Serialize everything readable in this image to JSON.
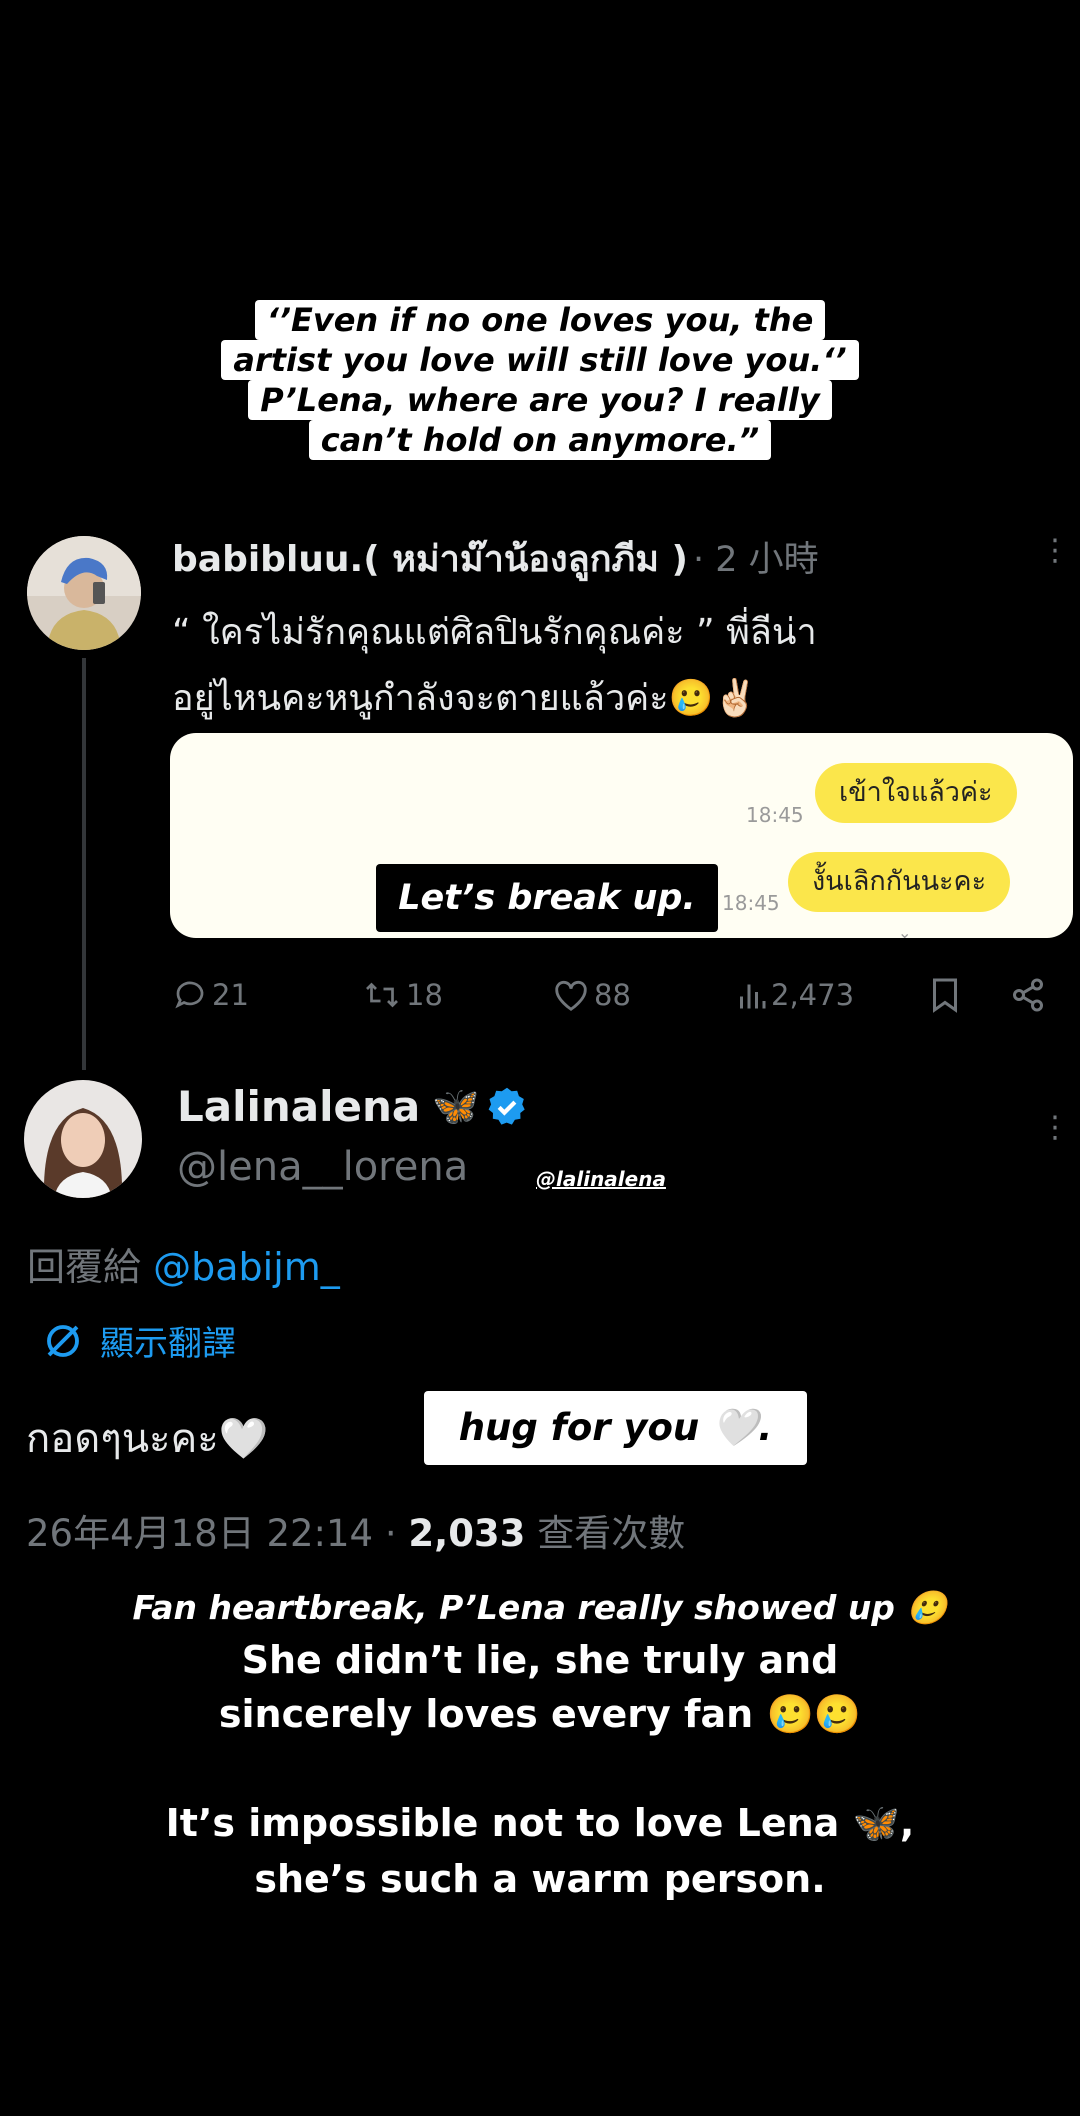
{
  "caption_top": {
    "lines": [
      "‘’Even if no one loves you, the",
      "artist you love will still love you.‘’",
      "P’Lena, where are you? I really",
      "can’t hold on anymore.”"
    ]
  },
  "first_post": {
    "display_name": "babibluu.( หม่าม๊าน้องลูกภีม )",
    "time": "· 2 小時",
    "text_line1": "“ ใครไม่รักคุณแต่ศิลปินรักคุณค่ะ ” พี่ลีน่า",
    "text_line2": "อยู่ไหนคะหนูกำลังจะตายแล้วค่ะ🥲✌🏻",
    "chat": {
      "bubble1": "เข้าใจแล้วค่ะ",
      "bubble2": "งั้นเลิกกันนะคะ",
      "time1": "18:45",
      "time2": "18:45",
      "overlay": "Let’s break up."
    },
    "stats": {
      "replies": "21",
      "reposts": "18",
      "likes": "88",
      "views": "2,473"
    }
  },
  "reply": {
    "display_name": "Lalinalena",
    "badge_emoji": "🦋",
    "handle": "@lena__lorena",
    "ig_tag": "@lalinalena",
    "reply_to_prefix": "回覆給",
    "reply_to_handle": "@babijm_",
    "translate_label": "顯示翻譯",
    "text": "กอดๆนะคะ🤍",
    "overlay": "hug for you 🤍.",
    "date": "26年4月18日 22:14 ·",
    "views_count": "2,033",
    "views_label": "查看次數"
  },
  "footer": {
    "line1": "Fan heartbreak, P’Lena really showed up 🥲",
    "line2": "She didn’t lie, she truly and",
    "line3": "sincerely loves every fan 🥲🥲",
    "line4": "It’s impossible not to love Lena 🦋,",
    "line5": "she’s such a warm person."
  },
  "colors": {
    "background": "#000000",
    "muted": "#71767b",
    "link": "#1d9bf0",
    "chat_bubble": "#fbe64b",
    "verified": "#1d9bf0"
  }
}
